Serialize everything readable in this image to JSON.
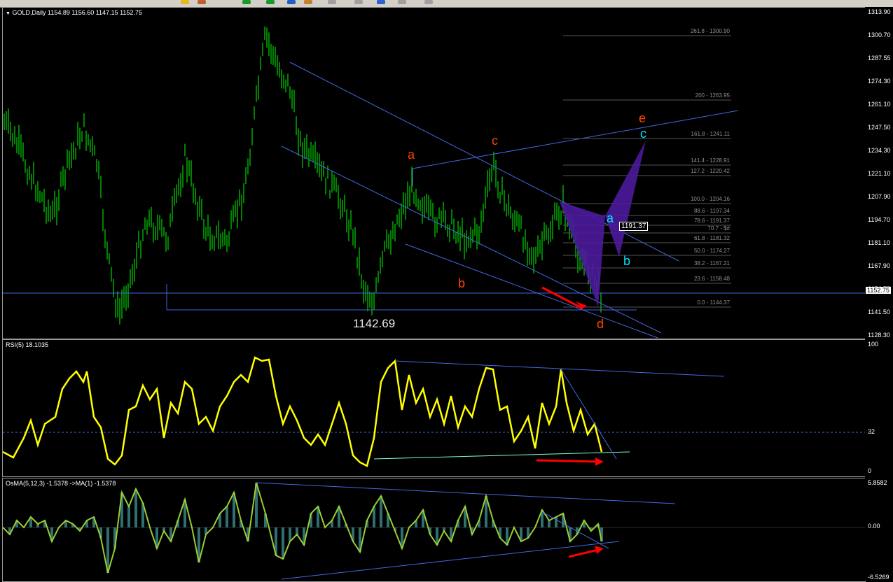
{
  "chart_window": {
    "symbol_label": "GOLD,Daily",
    "ohlc": "1154.89 1156.60 1147.15 1152.75",
    "low_annotation": "1142.69",
    "current_price": "1152.75",
    "price_marker": "1191.37"
  },
  "axes": {
    "main": [
      "1313.90",
      "1300.70",
      "1287.55",
      "1274.30",
      "1261.10",
      "1247.50",
      "1234.30",
      "1221.10",
      "1207.90",
      "1194.70",
      "1181.10",
      "1167.90",
      "1154.75",
      "1141.50",
      "1128.30"
    ],
    "rsi": [
      "100",
      "32",
      "0"
    ],
    "osma": [
      "5.8582",
      "0.00",
      "-6.5269"
    ]
  },
  "fibonacci_levels": [
    {
      "label": "261.8 - 1300.90"
    },
    {
      "label": "200 - 1263.95"
    },
    {
      "label": "161.8 - 1241.11"
    },
    {
      "label": "141.4 - 1228.91"
    },
    {
      "label": "127.2 - 1220.42"
    },
    {
      "label": "100.0 - 1204.16"
    },
    {
      "label": "88.6 - 1197.34"
    },
    {
      "label": "78.6 - 1191.37"
    },
    {
      "label": "70.7 - $#"
    },
    {
      "label": "61.8 - 1181.32"
    },
    {
      "label": "50.0 - 1174.27"
    },
    {
      "label": "38.2 - 1167.21"
    },
    {
      "label": "23.6 - 1158.48"
    },
    {
      "label": "0.0 - 1144.37"
    }
  ],
  "wave_labels": {
    "red": [
      "a",
      "b",
      "c",
      "d",
      "e"
    ],
    "cyan": [
      "a",
      "b",
      "c"
    ]
  },
  "indicators": {
    "rsi_label": "RSI(5) 18.1035",
    "osma_label": "OsMA(5,12,3) -1.5378  ->MA(1) -1.5378"
  },
  "colors": {
    "candles": "#00ff00",
    "rsi_line": "#ffff00",
    "osma_line": "#9acd32",
    "trend_lines": "#4169e1",
    "wave_red": "#ff4500",
    "wave_cyan": "#00e5ff",
    "pattern_fill": "#4b1a9c",
    "arrows": "#ff0000"
  }
}
